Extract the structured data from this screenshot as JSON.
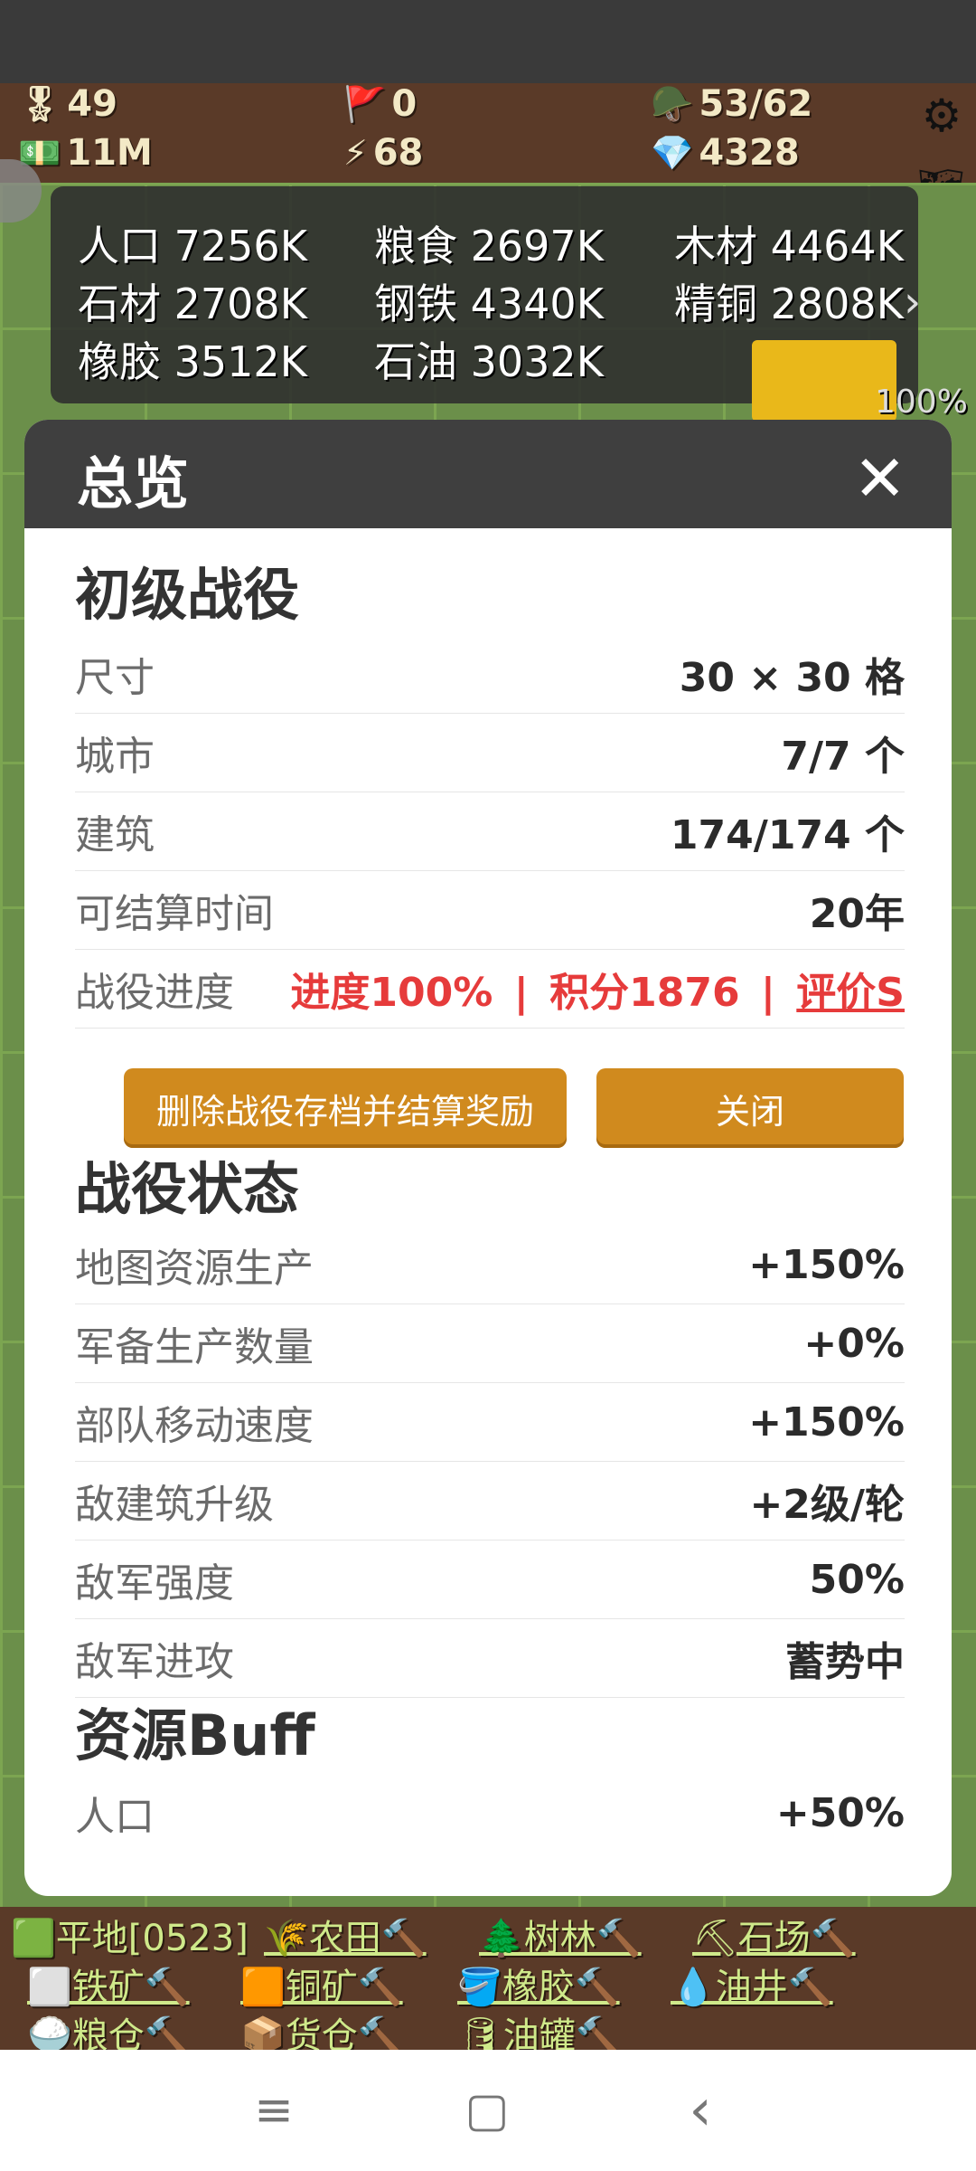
{
  "hud": {
    "medals": "49",
    "flags": "0",
    "troops": "53/62",
    "money": "11M",
    "energy": "68",
    "gems": "4328"
  },
  "resources": {
    "items": [
      {
        "label": "人口 7256K"
      },
      {
        "label": "粮食 2697K"
      },
      {
        "label": "木材 4464K"
      },
      {
        "label": "石材 2708K"
      },
      {
        "label": "钢铁 4340K"
      },
      {
        "label": "精铜 2808K"
      },
      {
        "label": "橡胶 3512K"
      },
      {
        "label": "石油 3032K"
      }
    ],
    "gift_percent": "100%"
  },
  "dialog": {
    "title": "总览",
    "close": "✕",
    "campaign": {
      "title": "初级战役",
      "rows": [
        {
          "k": "尺寸",
          "v": "30 × 30 格"
        },
        {
          "k": "城市",
          "v": "7/7 个"
        },
        {
          "k": "建筑",
          "v": "174/174 个"
        },
        {
          "k": "可结算时间",
          "v": "20年"
        }
      ],
      "progress_label": "战役进度",
      "progress": "进度100%",
      "score": "积分1876",
      "rating": "评价S",
      "separator": "|"
    },
    "buttons": {
      "delete": "删除战役存档并结算奖励",
      "close": "关闭"
    },
    "status": {
      "title": "战役状态",
      "rows": [
        {
          "k": "地图资源生产",
          "v": "+150%"
        },
        {
          "k": "军备生产数量",
          "v": "+0%"
        },
        {
          "k": "部队移动速度",
          "v": "+150%"
        },
        {
          "k": "敌建筑升级",
          "v": "+2级/轮"
        },
        {
          "k": "敌军强度",
          "v": "50%"
        },
        {
          "k": "敌军进攻",
          "v": "蓄势中"
        }
      ]
    },
    "buff": {
      "title": "资源Buff",
      "rows": [
        {
          "k": "人口",
          "v": "+50%"
        }
      ]
    }
  },
  "buildbar": {
    "items": [
      {
        "label": "🟩平地[0523]"
      },
      {
        "label": "🌾农田🔨"
      },
      {
        "label": "🌲树林🔨"
      },
      {
        "label": "⛏石场🔨"
      },
      {
        "label": "⬜铁矿🔨"
      },
      {
        "label": "🟧铜矿🔨"
      },
      {
        "label": "🪣橡胶🔨"
      },
      {
        "label": "💧油井🔨"
      },
      {
        "label": "🍚粮仓🔨"
      },
      {
        "label": "📦货仓🔨"
      },
      {
        "label": "🛢油罐🔨"
      }
    ]
  },
  "nav": {
    "menu": "≡",
    "home": "▢",
    "back": "‹"
  }
}
